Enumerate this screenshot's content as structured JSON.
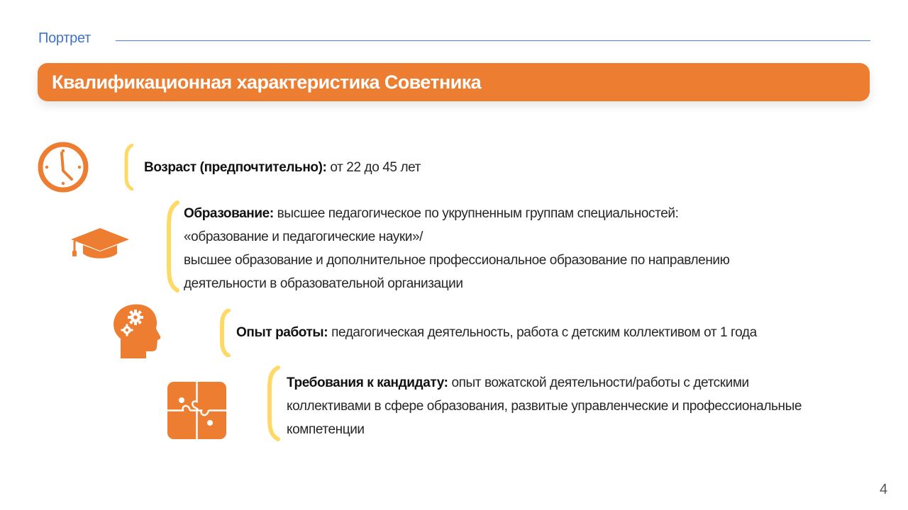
{
  "header": {
    "section_label": "Портрет",
    "title": "Квалификационная характеристика Советника"
  },
  "items": [
    {
      "icon": "clock-icon",
      "label": "Возраст (предпочтительно):",
      "text": "от 22 до 45 лет"
    },
    {
      "icon": "graduation-cap-icon",
      "label": "Образование:",
      "text": "высшее педагогическое по укрупненным группам специальностей:",
      "lines": [
        "«образование и педагогические науки»/",
        "высшее образование и дополнительное профессиональное образование по направлению",
        "деятельности в образовательной организации"
      ]
    },
    {
      "icon": "head-gears-icon",
      "label": "Опыт работы:",
      "text": "педагогическая деятельность, работа с детским коллективом от 1 года"
    },
    {
      "icon": "puzzle-icon",
      "label": "Требования к кандидату:",
      "text": "опыт вожатской деятельности/работы с детскими",
      "lines": [
        "коллективами в сфере образования, развитые управленческие и профессиональные",
        "компетенции"
      ]
    }
  ],
  "page_number": "4",
  "colors": {
    "accent_orange": "#ED7D31",
    "bracket_yellow": "#FFD966",
    "label_blue": "#3F73C9",
    "rule_blue": "#4A7FD0"
  }
}
